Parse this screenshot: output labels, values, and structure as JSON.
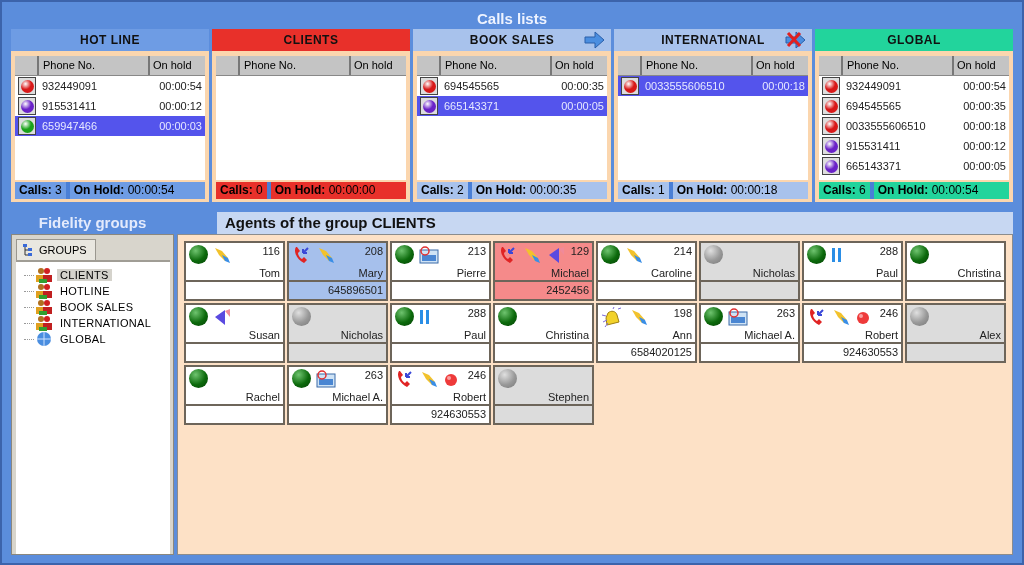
{
  "title": "Calls lists",
  "lists": [
    {
      "name": "HOT LINE",
      "kind": "plain",
      "color": "#6e9ce4",
      "columns": [
        "Phone No.",
        "On hold"
      ],
      "rows": [
        {
          "color": "#d81818",
          "phone": "932449091",
          "hold": "00:00:54",
          "selected": false
        },
        {
          "color": "#6a22c8",
          "phone": "915531411",
          "hold": "00:00:12",
          "selected": false
        },
        {
          "color": "#1aa21a",
          "phone": "659947466",
          "hold": "00:00:03",
          "selected": true
        }
      ],
      "footer": {
        "calls_label": "Calls:",
        "calls": "3",
        "hold_label": "On Hold:",
        "hold": "00:00:54"
      }
    },
    {
      "name": "CLIENTS",
      "kind": "plain",
      "color": "#e8302a",
      "columns": [
        "Phone No.",
        "On hold"
      ],
      "footer": {
        "calls_label": "Calls:",
        "calls": "0",
        "hold_label": "On Hold:",
        "hold": "00:00:00"
      }
    },
    {
      "name": "BOOK SALES",
      "kind": "forward",
      "color": "#a8c2ec",
      "columns": [
        "Phone No.",
        "On hold"
      ],
      "rows": [
        {
          "color": "#d81818",
          "phone": "694545565",
          "hold": "00:00:35",
          "selected": false
        },
        {
          "color": "#6a22c8",
          "phone": "665143371",
          "hold": "00:00:05",
          "selected": true
        }
      ],
      "footer": {
        "calls_label": "Calls:",
        "calls": "2",
        "hold_label": "On Hold:",
        "hold": "00:00:35"
      }
    },
    {
      "name": "INTERNATIONAL",
      "kind": "blocked",
      "color": "#a8c2ec",
      "columns": [
        "Phone No.",
        "On hold"
      ],
      "rows": [
        {
          "color": "#d81818",
          "phone": "0033555606510",
          "hold": "00:00:18",
          "selected": true
        }
      ],
      "footer": {
        "calls_label": "Calls:",
        "calls": "1",
        "hold_label": "On Hold:",
        "hold": "00:00:18"
      }
    },
    {
      "name": "GLOBAL",
      "kind": "plain",
      "color": "#22d49c",
      "columns": [
        "Phone No.",
        "On hold"
      ],
      "rows": [
        {
          "color": "#d81818",
          "phone": "932449091",
          "hold": "00:00:54",
          "selected": false
        },
        {
          "color": "#d81818",
          "phone": "694545565",
          "hold": "00:00:35",
          "selected": false
        },
        {
          "color": "#d81818",
          "phone": "0033555606510",
          "hold": "00:00:18",
          "selected": false
        },
        {
          "color": "#6a22c8",
          "phone": "915531411",
          "hold": "00:00:12",
          "selected": false
        },
        {
          "color": "#6a22c8",
          "phone": "665143371",
          "hold": "00:00:05",
          "selected": false
        }
      ],
      "footer": {
        "calls_label": "Calls:",
        "calls": "6",
        "hold_label": "On Hold:",
        "hold": "00:00:54"
      }
    }
  ],
  "groups": {
    "title": "Fidelity groups",
    "tab": "GROUPS",
    "items": [
      {
        "label": "CLIENTS",
        "kind": "group",
        "selected": true
      },
      {
        "label": "HOTLINE",
        "kind": "group",
        "selected": false
      },
      {
        "label": "BOOK SALES",
        "kind": "group",
        "selected": false
      },
      {
        "label": "INTERNATIONAL",
        "kind": "group",
        "selected": false
      },
      {
        "label": "GLOBAL",
        "kind": "global",
        "selected": false
      }
    ]
  },
  "agents_title": "Agents of the group CLIENTS",
  "agents": [
    {
      "name": "Tom",
      "ext": "116",
      "kind": "connected",
      "selected": false
    },
    {
      "name": "Mary",
      "ext": "208",
      "number": "645896501",
      "kind": "talking",
      "selected": true
    },
    {
      "name": "Pierre",
      "ext": "213",
      "kind": "sharing",
      "selected": false
    },
    {
      "name": "Michael",
      "ext": "129",
      "number": "2452456",
      "kind": "alert",
      "selected": false
    },
    {
      "name": "Caroline",
      "ext": "214",
      "kind": "connected",
      "selected": false
    },
    {
      "name": "Nicholas",
      "kind": "offline",
      "selected": false
    },
    {
      "name": "Paul",
      "ext": "288",
      "kind": "paused",
      "selected": false
    },
    {
      "name": "Christina",
      "kind": "idle",
      "selected": false
    },
    {
      "name": "Susan",
      "kind": "announcing",
      "selected": false
    },
    {
      "name": "Nicholas",
      "kind": "offline",
      "selected": false
    },
    {
      "name": "Paul",
      "ext": "288",
      "kind": "paused",
      "selected": false
    },
    {
      "name": "Christina",
      "kind": "idle",
      "selected": false
    },
    {
      "name": "Ann",
      "ext": "198",
      "number": "6584020125",
      "kind": "ringing",
      "selected": false
    },
    {
      "name": "Michael A.",
      "ext": "263",
      "kind": "sharing",
      "selected": false
    },
    {
      "name": "Robert",
      "ext": "246",
      "number": "924630553",
      "kind": "recording",
      "selected": false
    },
    {
      "name": "Alex",
      "kind": "offline",
      "selected": false
    },
    {
      "name": "Rachel",
      "kind": "idle",
      "selected": false
    },
    {
      "name": "Michael A.",
      "ext": "263",
      "kind": "sharing",
      "selected": false
    },
    {
      "name": "Robert",
      "ext": "246",
      "number": "924630553",
      "kind": "recording",
      "selected": false
    },
    {
      "name": "Stephen",
      "kind": "offline",
      "selected": false
    }
  ]
}
